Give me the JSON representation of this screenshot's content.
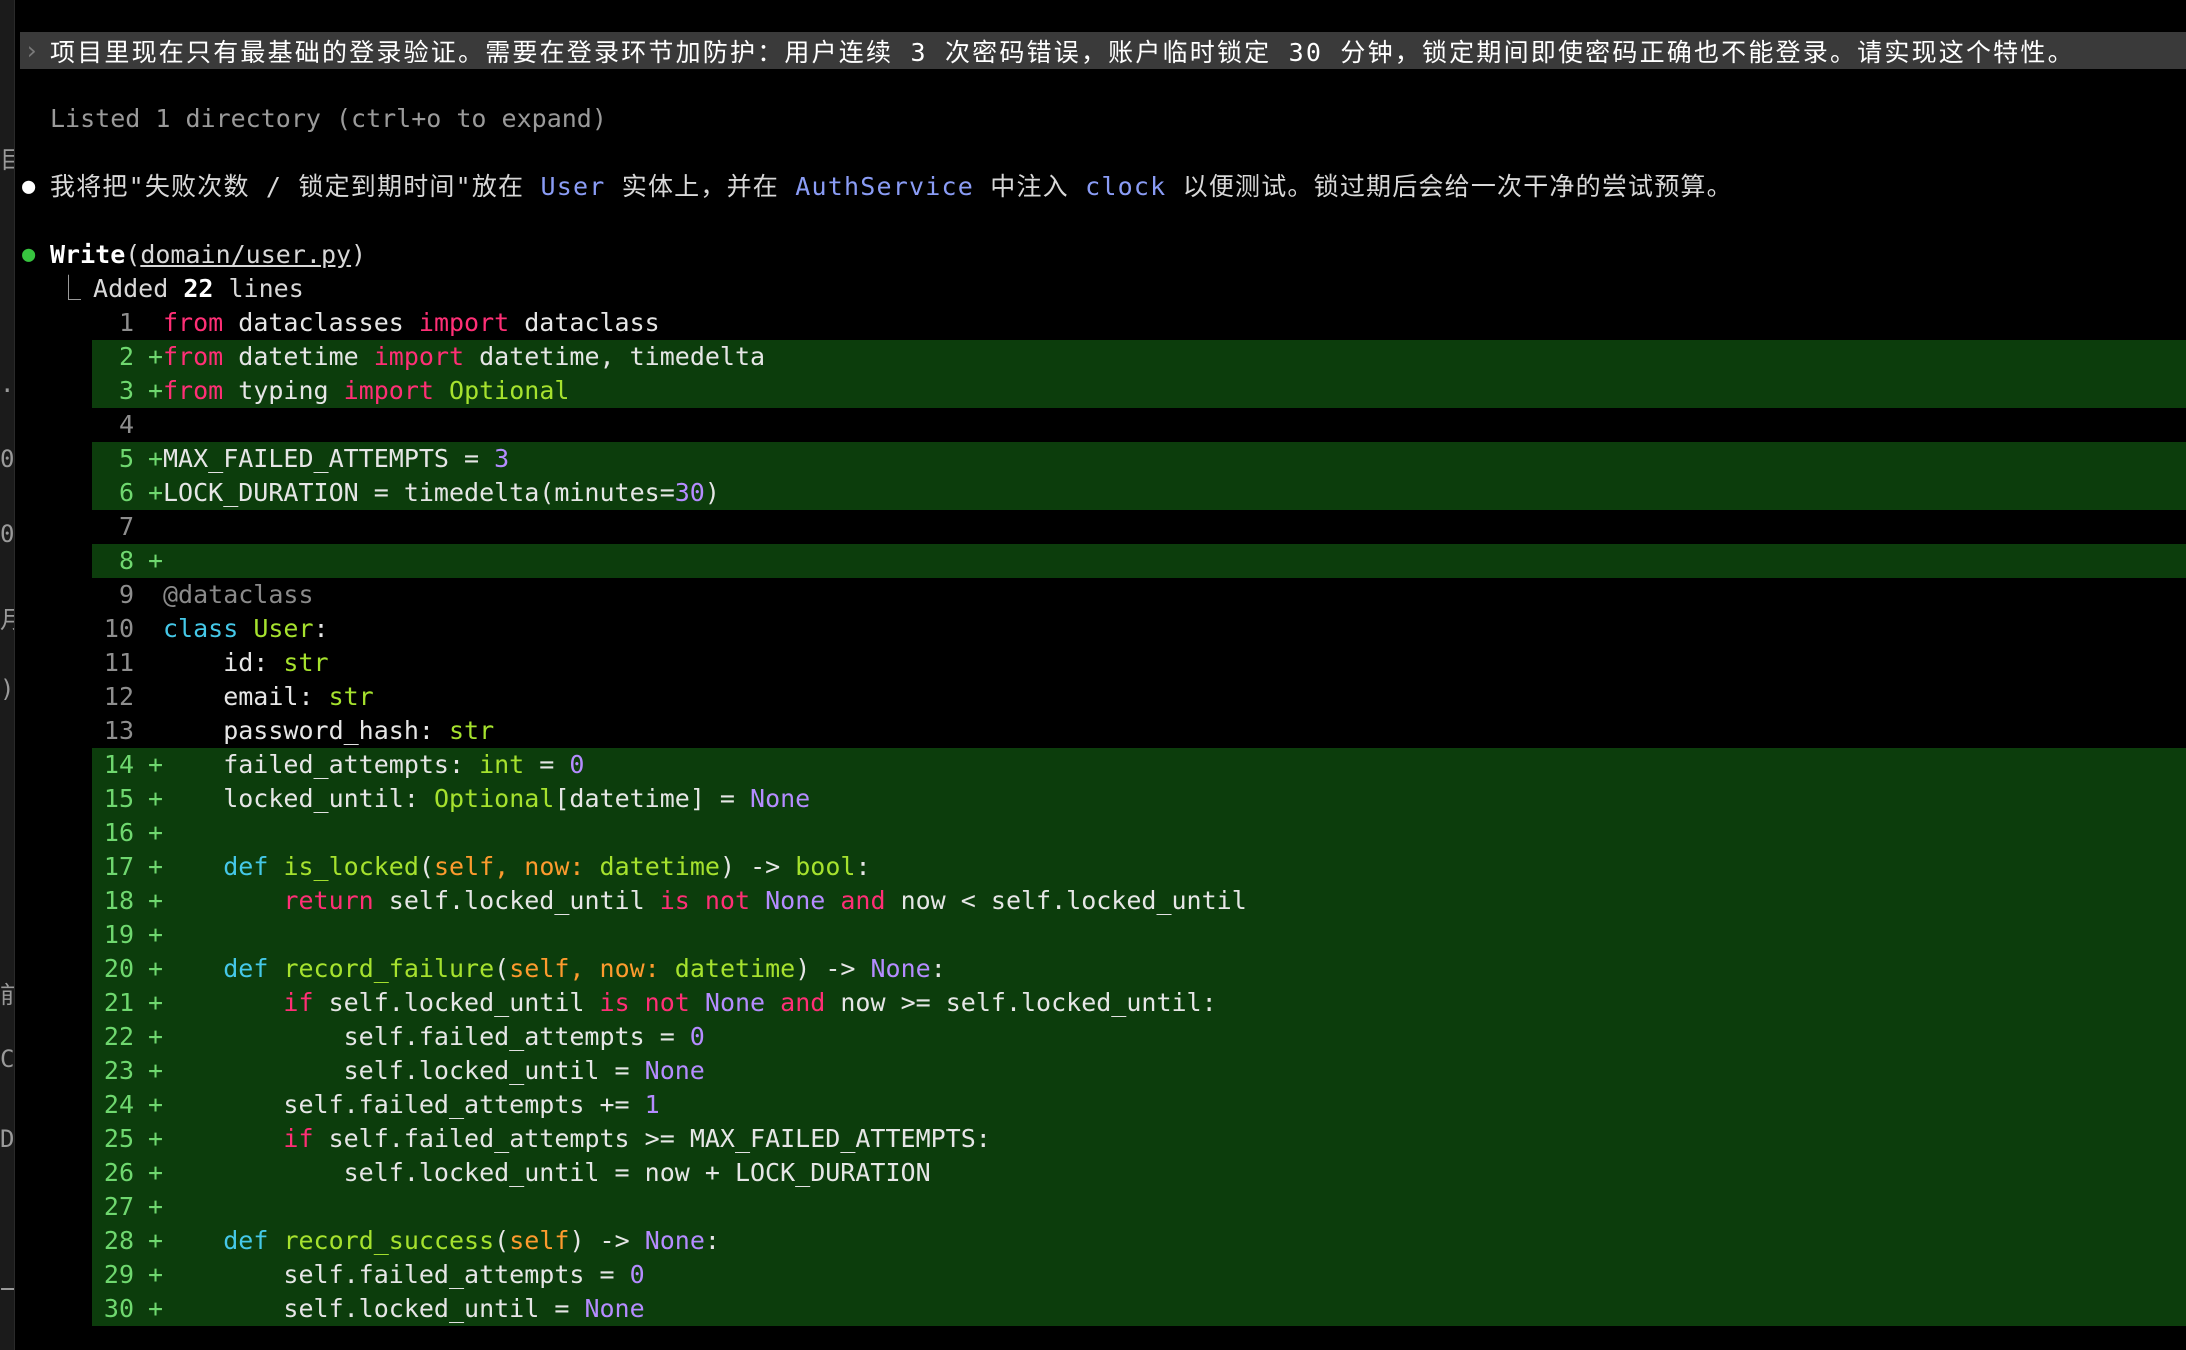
{
  "terminal": {
    "prompt": "项目里现在只有最基础的登录验证。需要在登录环节加防护：用户连续 3 次密码错误，账户临时锁定 30 分钟，锁定期间即使密码正确也不能登录。请实现这个特性。",
    "prompt_chevron": "›",
    "listed_note": "Listed 1 directory (ctrl+o to expand)",
    "assistant_message": {
      "part1": "我将把\"失败次数 / 锁定到期时间\"放在 ",
      "entity": "User",
      "part2": " 实体上，并在 ",
      "service": "AuthService",
      "part3": " 中注入 ",
      "clock": "clock",
      "part4": " 以便测试。锁过期后会给一次干净的尝试预算。"
    },
    "tool_call": {
      "name": "Write",
      "open_paren": "(",
      "path": "domain/user.py",
      "close_paren": ")",
      "connector": "⎿",
      "summary_pre": "Added ",
      "count": "22",
      "summary_post": " lines"
    },
    "left_edge_glyphs": [
      "目",
      "..",
      "0",
      "0",
      "月",
      ")",
      "前",
      "C",
      "D",
      "一"
    ]
  },
  "colors": {
    "background": "#000000",
    "prompt_bg": "#3a3a3a",
    "added_row_bg": "#0c3d0c",
    "keyword": "#ff2f76",
    "type": "#a6e22e",
    "class_def": "#45c8e8",
    "number_none": "#b58cff",
    "param": "#fd9b2e",
    "highlight": "#8a9cf5"
  },
  "diff_lines": [
    {
      "n": "1",
      "added": false,
      "tokens": [
        [
          "kw",
          "from"
        ],
        [
          "p",
          " dataclasses "
        ],
        [
          "kw",
          "import"
        ],
        [
          "p",
          " dataclass"
        ]
      ]
    },
    {
      "n": "2",
      "added": true,
      "tokens": [
        [
          "kw",
          "from"
        ],
        [
          "p",
          " datetime "
        ],
        [
          "kw",
          "import"
        ],
        [
          "p",
          " datetime, timedelta"
        ]
      ]
    },
    {
      "n": "3",
      "added": true,
      "tokens": [
        [
          "kw",
          "from"
        ],
        [
          "p",
          " typing "
        ],
        [
          "kw",
          "import"
        ],
        [
          "p",
          " "
        ],
        [
          "ty",
          "Optional"
        ]
      ]
    },
    {
      "n": "4",
      "added": false,
      "tokens": []
    },
    {
      "n": "5",
      "added": true,
      "tokens": [
        [
          "p",
          "MAX_FAILED_ATTEMPTS = "
        ],
        [
          "nm",
          "3"
        ]
      ]
    },
    {
      "n": "6",
      "added": true,
      "tokens": [
        [
          "p",
          "LOCK_DURATION = timedelta(minutes="
        ],
        [
          "nm",
          "30"
        ],
        [
          "p",
          ")"
        ]
      ]
    },
    {
      "n": "7",
      "added": false,
      "tokens": []
    },
    {
      "n": "8",
      "added": true,
      "tokens": []
    },
    {
      "n": "9",
      "added": false,
      "tokens": [
        [
          "dec",
          "@dataclass"
        ]
      ]
    },
    {
      "n": "10",
      "added": false,
      "tokens": [
        [
          "cl",
          "class"
        ],
        [
          "p",
          " "
        ],
        [
          "ty",
          "User"
        ],
        [
          "p",
          ":"
        ]
      ]
    },
    {
      "n": "11",
      "added": false,
      "tokens": [
        [
          "p",
          "    id: "
        ],
        [
          "ty",
          "str"
        ]
      ]
    },
    {
      "n": "12",
      "added": false,
      "tokens": [
        [
          "p",
          "    email: "
        ],
        [
          "ty",
          "str"
        ]
      ]
    },
    {
      "n": "13",
      "added": false,
      "tokens": [
        [
          "p",
          "    password_hash: "
        ],
        [
          "ty",
          "str"
        ]
      ]
    },
    {
      "n": "14",
      "added": true,
      "tokens": [
        [
          "p",
          "    failed_attempts: "
        ],
        [
          "ty",
          "int"
        ],
        [
          "p",
          " = "
        ],
        [
          "nm",
          "0"
        ]
      ]
    },
    {
      "n": "15",
      "added": true,
      "tokens": [
        [
          "p",
          "    locked_until: "
        ],
        [
          "ty",
          "Optional"
        ],
        [
          "p",
          "[datetime] = "
        ],
        [
          "nm",
          "None"
        ]
      ]
    },
    {
      "n": "16",
      "added": true,
      "tokens": []
    },
    {
      "n": "17",
      "added": true,
      "tokens": [
        [
          "p",
          "    "
        ],
        [
          "cl",
          "def"
        ],
        [
          "p",
          " "
        ],
        [
          "ty",
          "is_locked"
        ],
        [
          "p",
          "("
        ],
        [
          "pm",
          "self, now: "
        ],
        [
          "ty",
          "datetime"
        ],
        [
          "p",
          ") -> "
        ],
        [
          "ty",
          "bool"
        ],
        [
          "p",
          ":"
        ]
      ]
    },
    {
      "n": "18",
      "added": true,
      "tokens": [
        [
          "p",
          "        "
        ],
        [
          "kw",
          "return"
        ],
        [
          "p",
          " self.locked_until "
        ],
        [
          "kw",
          "is not"
        ],
        [
          "p",
          " "
        ],
        [
          "nm",
          "None"
        ],
        [
          "p",
          " "
        ],
        [
          "kw",
          "and"
        ],
        [
          "p",
          " now < self.locked_until"
        ]
      ]
    },
    {
      "n": "19",
      "added": true,
      "tokens": []
    },
    {
      "n": "20",
      "added": true,
      "tokens": [
        [
          "p",
          "    "
        ],
        [
          "cl",
          "def"
        ],
        [
          "p",
          " "
        ],
        [
          "ty",
          "record_failure"
        ],
        [
          "p",
          "("
        ],
        [
          "pm",
          "self, now: "
        ],
        [
          "ty",
          "datetime"
        ],
        [
          "p",
          ") -> "
        ],
        [
          "nm",
          "None"
        ],
        [
          "p",
          ":"
        ]
      ]
    },
    {
      "n": "21",
      "added": true,
      "tokens": [
        [
          "p",
          "        "
        ],
        [
          "kw",
          "if"
        ],
        [
          "p",
          " self.locked_until "
        ],
        [
          "kw",
          "is not"
        ],
        [
          "p",
          " "
        ],
        [
          "nm",
          "None"
        ],
        [
          "p",
          " "
        ],
        [
          "kw",
          "and"
        ],
        [
          "p",
          " now >= self.locked_until:"
        ]
      ]
    },
    {
      "n": "22",
      "added": true,
      "tokens": [
        [
          "p",
          "            self.failed_attempts = "
        ],
        [
          "nm",
          "0"
        ]
      ]
    },
    {
      "n": "23",
      "added": true,
      "tokens": [
        [
          "p",
          "            self.locked_until = "
        ],
        [
          "nm",
          "None"
        ]
      ]
    },
    {
      "n": "24",
      "added": true,
      "tokens": [
        [
          "p",
          "        self.failed_attempts += "
        ],
        [
          "nm",
          "1"
        ]
      ]
    },
    {
      "n": "25",
      "added": true,
      "tokens": [
        [
          "p",
          "        "
        ],
        [
          "kw",
          "if"
        ],
        [
          "p",
          " self.failed_attempts >= MAX_FAILED_ATTEMPTS:"
        ]
      ]
    },
    {
      "n": "26",
      "added": true,
      "tokens": [
        [
          "p",
          "            self.locked_until = now + LOCK_DURATION"
        ]
      ]
    },
    {
      "n": "27",
      "added": true,
      "tokens": []
    },
    {
      "n": "28",
      "added": true,
      "tokens": [
        [
          "p",
          "    "
        ],
        [
          "cl",
          "def"
        ],
        [
          "p",
          " "
        ],
        [
          "ty",
          "record_success"
        ],
        [
          "p",
          "("
        ],
        [
          "pm",
          "self"
        ],
        [
          "p",
          ") -> "
        ],
        [
          "nm",
          "None"
        ],
        [
          "p",
          ":"
        ]
      ]
    },
    {
      "n": "29",
      "added": true,
      "tokens": [
        [
          "p",
          "        self.failed_attempts = "
        ],
        [
          "nm",
          "0"
        ]
      ]
    },
    {
      "n": "30",
      "added": true,
      "tokens": [
        [
          "p",
          "        self.locked_until = "
        ],
        [
          "nm",
          "None"
        ]
      ]
    }
  ]
}
